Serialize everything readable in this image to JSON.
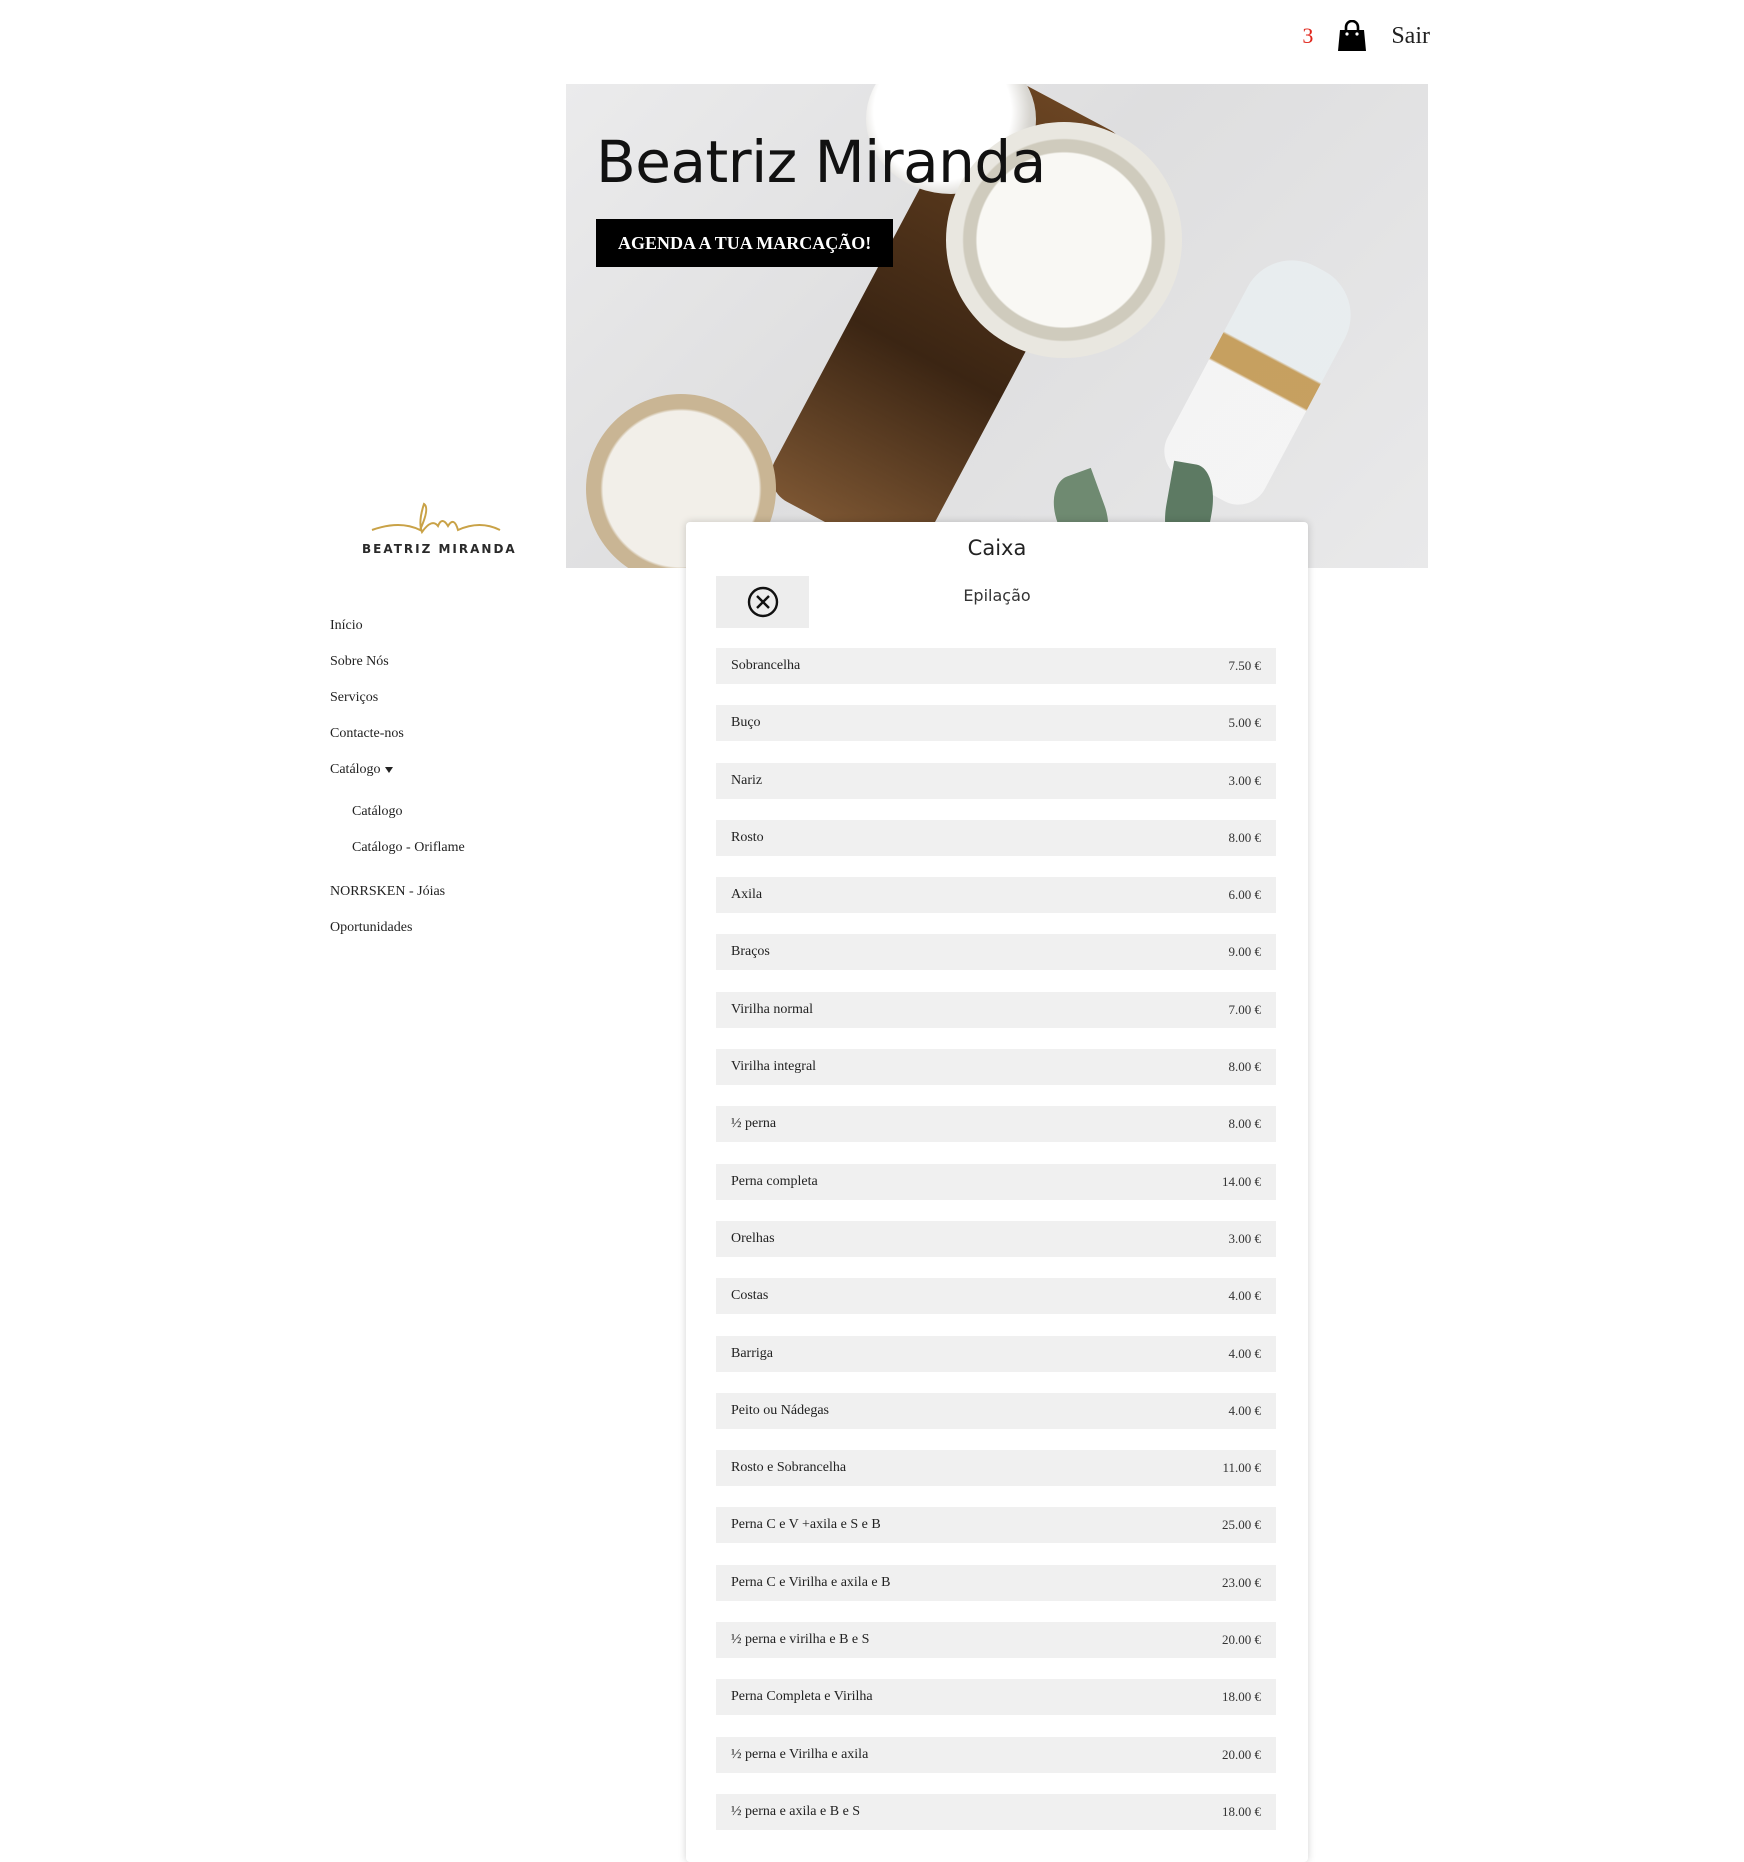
{
  "header": {
    "cart_count": "3",
    "logout_label": "Sair"
  },
  "hero": {
    "title": "Beatriz Miranda",
    "cta_label": "AGENDA A TUA MARCAÇÃO!"
  },
  "brand": {
    "logo_text": "BEATRIZ MIRANDA"
  },
  "nav": {
    "items": [
      "Início",
      "Sobre Nós",
      "Serviços",
      "Contacte-nos",
      "Catálogo"
    ],
    "catalog_sub": [
      "Catálogo",
      "Catálogo - Oriflame"
    ],
    "after": [
      "NORRSKEN - Jóias",
      "Oportunidades"
    ]
  },
  "checkout": {
    "title": "Caixa",
    "category": "Epilação",
    "close_icon": "close-circle-icon",
    "items": [
      {
        "name": "Sobrancelha",
        "price": "7.50 €"
      },
      {
        "name": "Buço",
        "price": "5.00 €"
      },
      {
        "name": "Nariz",
        "price": "3.00 €"
      },
      {
        "name": "Rosto",
        "price": "8.00 €"
      },
      {
        "name": "Axila",
        "price": "6.00 €"
      },
      {
        "name": "Braços",
        "price": "9.00 €"
      },
      {
        "name": "Virilha normal",
        "price": "7.00 €"
      },
      {
        "name": "Virilha integral",
        "price": "8.00 €"
      },
      {
        "name": "½ perna",
        "price": "8.00 €"
      },
      {
        "name": "Perna completa",
        "price": "14.00 €"
      },
      {
        "name": "Orelhas",
        "price": "3.00 €"
      },
      {
        "name": "Costas",
        "price": "4.00 €"
      },
      {
        "name": "Barriga",
        "price": "4.00 €"
      },
      {
        "name": "Peito ou Nádegas",
        "price": "4.00 €"
      },
      {
        "name": "Rosto e Sobrancelha",
        "price": "11.00 €"
      },
      {
        "name": "Perna C e V +axila e S e B",
        "price": "25.00 €"
      },
      {
        "name": "Perna C e Virilha e axila e B",
        "price": "23.00 €"
      },
      {
        "name": "½ perna e virilha e B e S",
        "price": "20.00 €"
      },
      {
        "name": "Perna Completa e Virilha",
        "price": "18.00 €"
      },
      {
        "name": "½ perna e Virilha e axila",
        "price": "20.00 €"
      },
      {
        "name": "½ perna e axila e B e S",
        "price": "18.00 €"
      }
    ]
  },
  "colors": {
    "accent": "#e0251b",
    "logo_gold": "#c9a247",
    "item_bg": "#f0f0f0"
  }
}
